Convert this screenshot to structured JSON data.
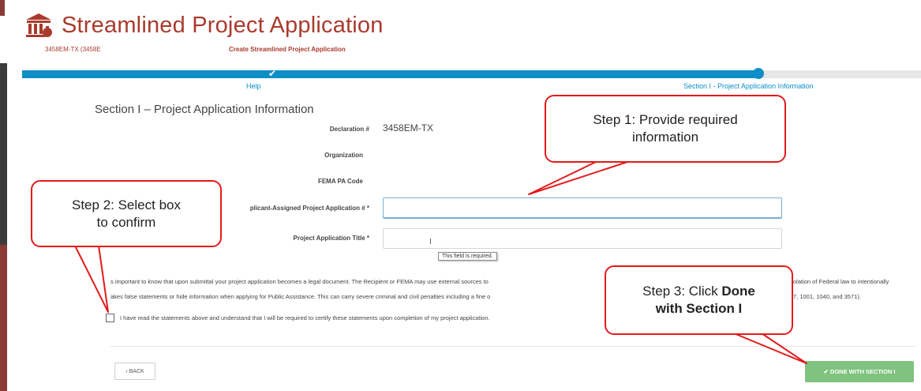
{
  "app": {
    "title": "Streamlined Project Application",
    "crumb_left": "3458EM-TX (3458E",
    "crumb_mid": "Create Streamlined Project Application"
  },
  "progress": {
    "steps": [
      "Help",
      "Section I - Project Application Information"
    ],
    "check_glyph": "✔"
  },
  "section": {
    "title": "Section I – Project Application Information"
  },
  "fields": {
    "declaration_label": "Declaration #",
    "declaration_value": "3458EM-TX",
    "organization_label": "Organization",
    "pa_code_label": "FEMA PA Code",
    "app_number_label": "plicant-Assigned Project Application # *",
    "app_title_label": "Project Application Title *",
    "required_tip": "This field is required."
  },
  "legal": {
    "line1": "s important to know that upon submittal your project application becomes a legal document. The Recipient or FEMA may use external sources to",
    "line1_right": "olation of Federal law to intentionally",
    "line2": "akes false statements or hide information when applying for Public Assistance. This can carry severe criminal and civil penalties including a fine o",
    "line2_right": "7, 1001, 1040, and 3571).",
    "checkbox_label": "I have read the statements above and understand that I will be required to certify these statements upon completion of my project application."
  },
  "buttons": {
    "back": "‹ BACK",
    "done": "✔ DONE WITH SECTION I"
  },
  "callouts": {
    "step1_line1": "Step 1: Provide required",
    "step1_line2": "information",
    "step2_line1": "Step 2: Select box",
    "step2_line2": "to confirm",
    "step3_line1_prefix": "Step 3: Click ",
    "step3_line1_bold": "Done",
    "step3_line2": "with Section I"
  },
  "colors": {
    "brand_red": "#a93b2e",
    "progress_blue": "#0c8fc8",
    "callout_red": "#e21b1b",
    "done_green": "#7fc37f"
  },
  "icons": {
    "logo": "courthouse-icon"
  }
}
